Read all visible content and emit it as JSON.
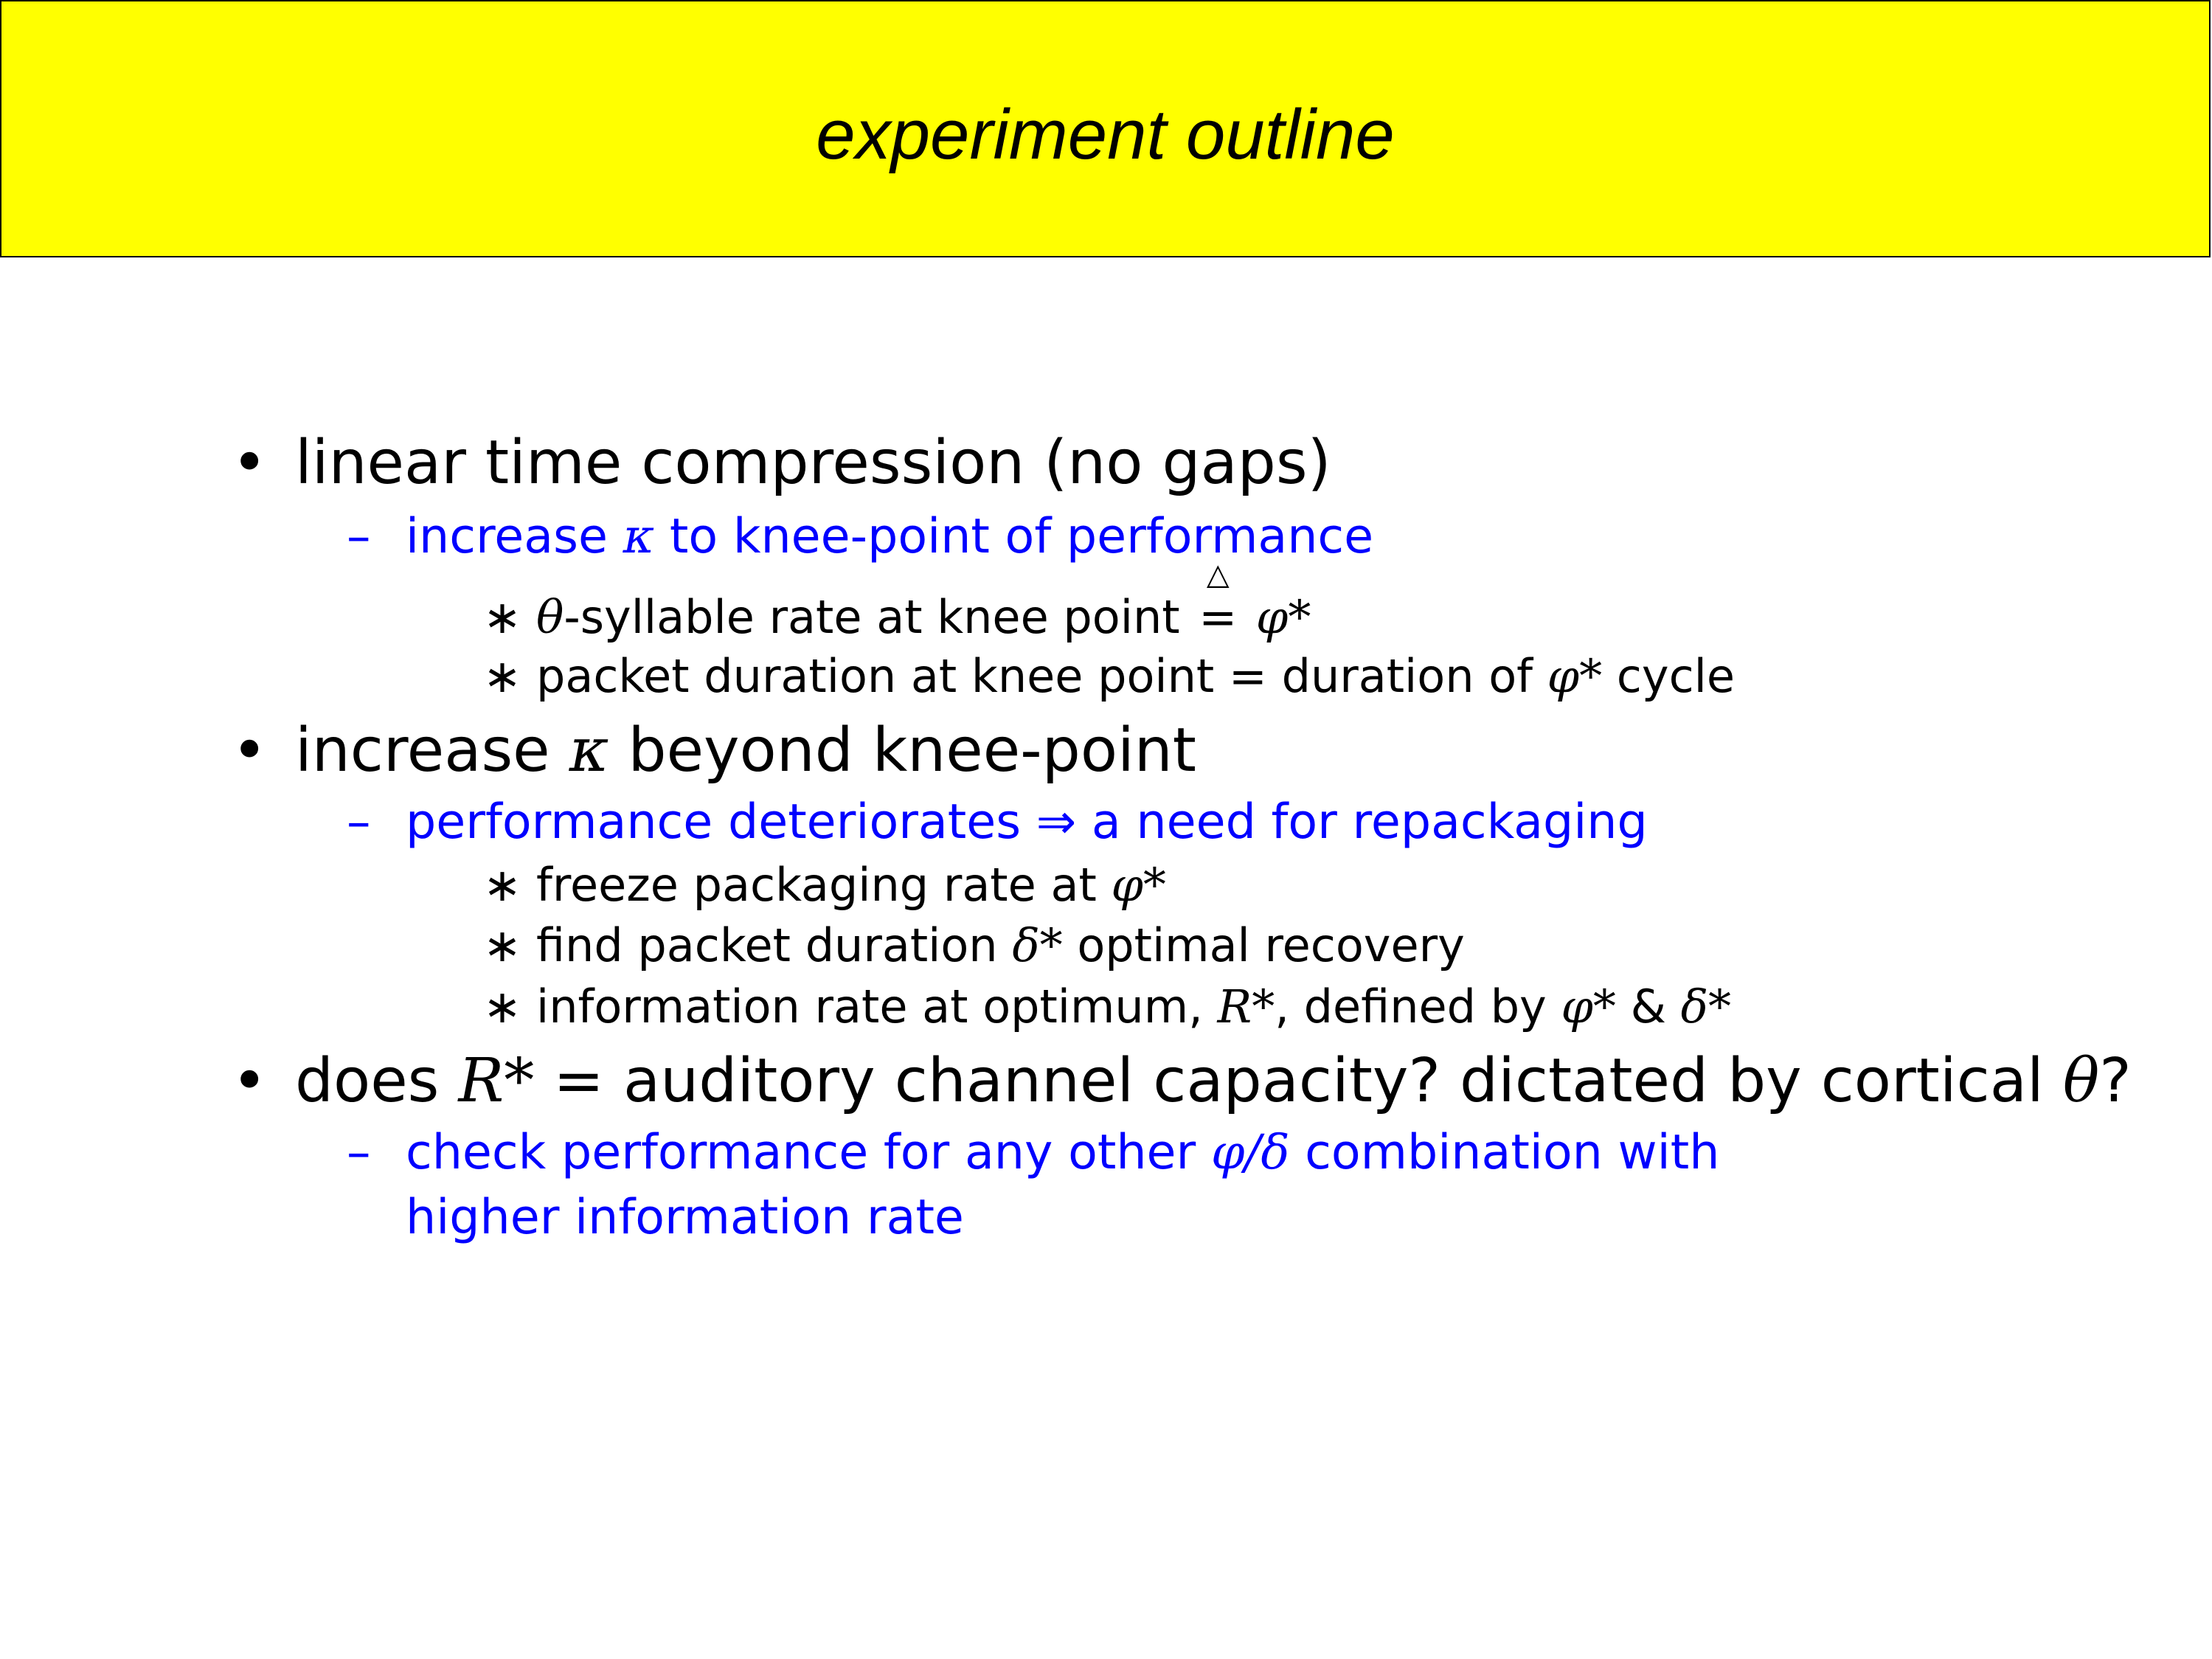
{
  "slide": {
    "title": "experiment outline"
  },
  "outline": {
    "b1": {
      "bullet": "•",
      "text": "linear time compression (no gaps)"
    },
    "b1_sub": {
      "dash": "–",
      "pre": "increase ",
      "kappa": "κ",
      "post": " to knee-point of performance"
    },
    "b1_s1": {
      "star": "∗",
      "theta": "θ",
      "pre": "-syllable rate at knee point ",
      "triangle": "△",
      "eq": "=",
      "phi": "φ*"
    },
    "b1_s2": {
      "star": "∗",
      "pre": "packet duration at knee point = duration of ",
      "phi": "φ*",
      "post": " cycle"
    },
    "b2": {
      "bullet": "•",
      "pre": "increase ",
      "kappa": "κ",
      "post": " beyond knee-point"
    },
    "b2_sub": {
      "dash": "–",
      "text": "performance deteriorates ⇒ a need for repackaging"
    },
    "b2_s1": {
      "star": "∗",
      "pre": "freeze packaging rate at ",
      "phi": "φ*"
    },
    "b2_s2": {
      "star": "∗",
      "pre": "find packet duration ",
      "delta": "δ*",
      "post": " optimal recovery"
    },
    "b2_s3": {
      "star": "∗",
      "pre": "information rate at optimum, ",
      "r": "R*",
      "mid": ", defined by ",
      "phi": "φ*",
      "amp": " & ",
      "delta": "δ*"
    },
    "b3": {
      "bullet": "•",
      "pre": "does ",
      "r": "R*",
      "mid": " = auditory channel capacity?  dictated by cortical ",
      "theta": "θ",
      "post": "?"
    },
    "b3_sub": {
      "dash": "–",
      "pre": "check performance for any other ",
      "phidelta": "φ/δ",
      "post": " combination with",
      "cont": "higher information rate"
    }
  }
}
